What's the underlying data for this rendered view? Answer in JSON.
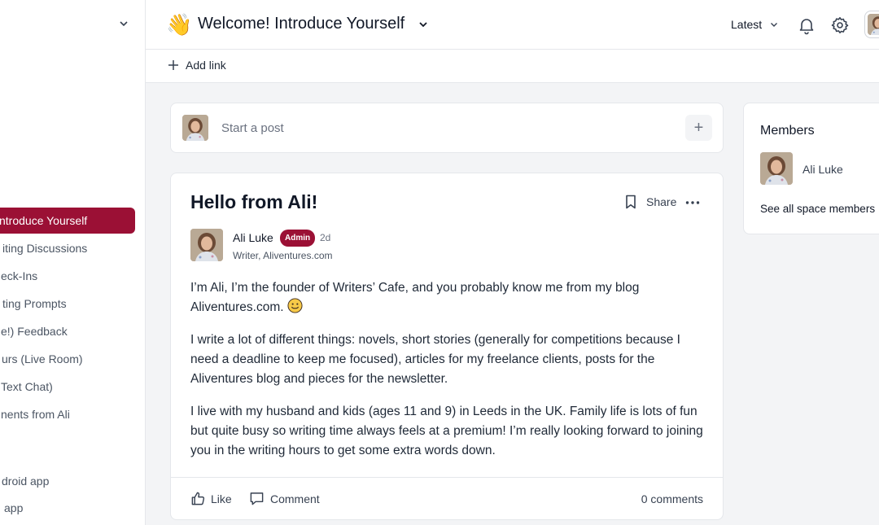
{
  "sidebar": {
    "items": [
      {
        "label": "ntroduce Yourself",
        "active": true
      },
      {
        "label": "iting Discussions",
        "active": false
      },
      {
        "label": "eck-Ins",
        "active": false
      },
      {
        "label": "ting Prompts",
        "active": false
      },
      {
        "label": "e!) Feedback",
        "active": false
      },
      {
        "label": "urs (Live Room)",
        "active": false
      },
      {
        "label": "Text Chat)",
        "active": false
      },
      {
        "label": "nents from Ali",
        "active": false
      },
      {
        "label": "droid app",
        "active": false
      },
      {
        "label": "app",
        "active": false
      }
    ]
  },
  "header": {
    "space_emoji": "👋",
    "space_title": "Welcome! Introduce Yourself",
    "sort_label": "Latest"
  },
  "subheader": {
    "add_link_label": "Add link"
  },
  "composer": {
    "placeholder": "Start a post",
    "plus_label": "+"
  },
  "post": {
    "title": "Hello from Ali!",
    "share_label": "Share",
    "author_name": "Ali Luke",
    "author_badge": "Admin",
    "age": "2d",
    "author_headline": "Writer, Aliventures.com",
    "paragraphs": [
      "I’m Ali, I’m the founder of Writers’ Cafe, and you probably know me from my blog Aliventures.com.",
      "I write a lot of different things: novels, short stories (generally for competitions because I need a deadline to keep me focused), articles for my freelance clients, posts for the Aliventures blog and pieces for the newsletter.",
      "I live with my husband and kids (ages 11 and 9) in Leeds in the UK. Family life is lots of fun but quite busy so writing time always feels at a premium! I’m really looking forward to joining you in the writing hours to get some extra words down."
    ],
    "like_label": "Like",
    "comment_label": "Comment",
    "comments_count": "0 comments"
  },
  "members": {
    "title": "Members",
    "items": [
      {
        "name": "Ali Luke"
      }
    ],
    "see_all_label": "See all space members"
  },
  "colors": {
    "accent": "#9b1035",
    "border": "#e5e7eb",
    "background": "#f3f4f6"
  }
}
